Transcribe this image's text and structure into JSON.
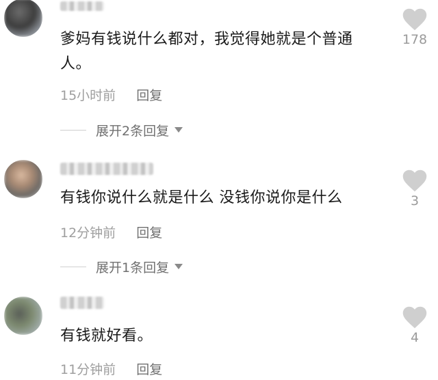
{
  "comments": [
    {
      "text": "爹妈有钱说什么都对，我觉得她就是个普通人。",
      "time": "15小时前",
      "reply_label": "回复",
      "expand_label": "展开2条回复",
      "like_count": "178"
    },
    {
      "text": "有钱你说什么就是什么 没钱你说你是什么",
      "time": "12分钟前",
      "reply_label": "回复",
      "expand_label": "展开1条回复",
      "like_count": "3"
    },
    {
      "text": "有钱就好看。",
      "time": "11分钟前",
      "reply_label": "回复",
      "like_count": "4"
    }
  ],
  "icons": {
    "like": "heart-icon",
    "expand": "caret-down-icon"
  },
  "colors": {
    "heart": "#cfcfcf",
    "text": "#1a1a1a",
    "meta": "#9e9e9e",
    "action": "#707070"
  }
}
